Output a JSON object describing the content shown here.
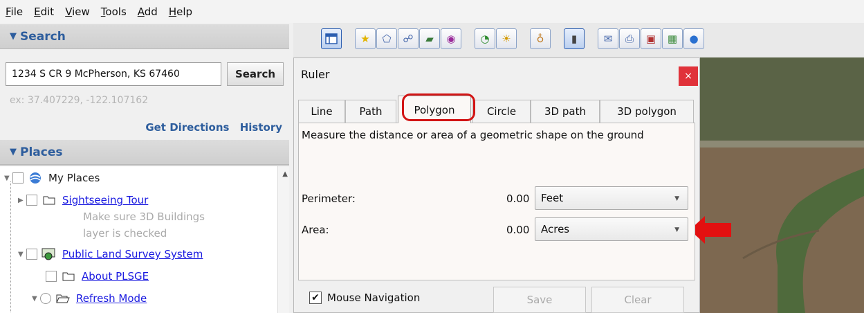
{
  "menu": [
    "File",
    "Edit",
    "View",
    "Tools",
    "Add",
    "Help"
  ],
  "search_panel": {
    "header": "Search",
    "input_value": "1234 S CR 9 McPherson, KS 67460",
    "button_label": "Search",
    "hint": "ex: 37.407229, -122.107162",
    "get_directions": "Get Directions",
    "history": "History"
  },
  "places_panel": {
    "header": "Places",
    "items": [
      {
        "label": "My Places",
        "link": false
      },
      {
        "label": "Sightseeing Tour",
        "link": true
      },
      {
        "label": "Make sure 3D Buildings",
        "link": false
      },
      {
        "label": "layer is checked",
        "link": false
      },
      {
        "label": "Public Land Survey System",
        "link": true
      },
      {
        "label": "About PLSGE",
        "link": true
      },
      {
        "label": "Refresh Mode",
        "link": true
      }
    ]
  },
  "toolbar": {
    "icons": [
      "sidebar-icon",
      "placemark-icon",
      "polygon-icon",
      "path-icon",
      "image-overlay-icon",
      "record-tour-icon",
      "historical-imagery-icon",
      "sunlight-icon",
      "planets-icon",
      "ruler-icon",
      "email-icon",
      "print-icon",
      "save-image-icon",
      "view-in-maps-icon",
      "earth-icon"
    ]
  },
  "ruler": {
    "title": "Ruler",
    "close": "×",
    "tabs": [
      "Line",
      "Path",
      "Polygon",
      "Circle",
      "3D path",
      "3D polygon"
    ],
    "selected_tab": "Polygon",
    "description": "Measure the distance or area of a geometric shape on the ground",
    "perimeter_label": "Perimeter:",
    "perimeter_value": "0.00",
    "perimeter_unit": "Feet",
    "area_label": "Area:",
    "area_value": "0.00",
    "area_unit": "Acres",
    "mouse_navigation_label": "Mouse Navigation",
    "mouse_navigation_checked": true,
    "save_label": "Save",
    "clear_label": "Clear"
  },
  "colors": {
    "accent": "#2d5d9d",
    "link": "#1a1ae0",
    "annotation": "#d21515",
    "close": "#e0323a"
  }
}
